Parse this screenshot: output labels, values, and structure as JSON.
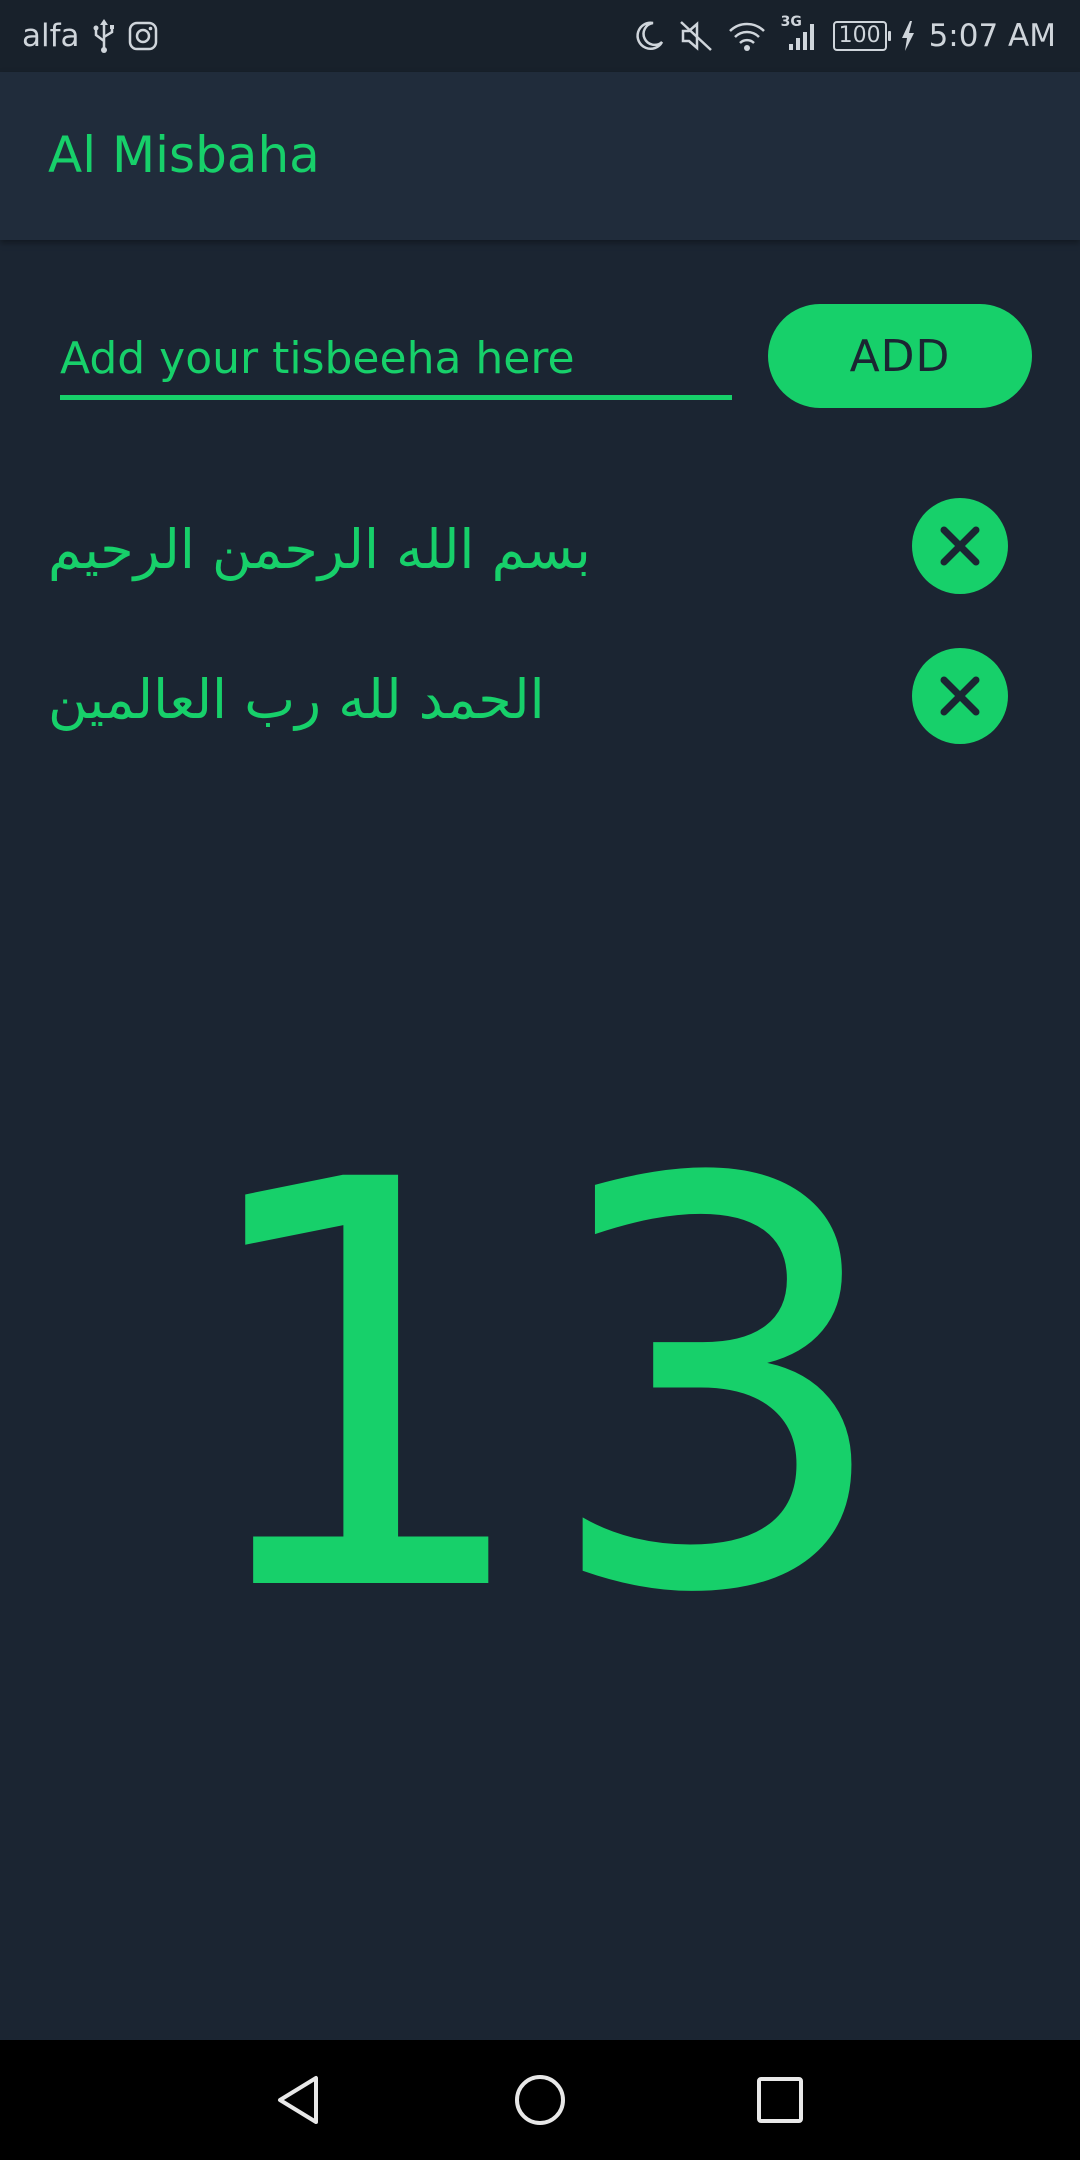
{
  "status_bar": {
    "carrier": "alfa",
    "network": "3G",
    "battery": "100",
    "time": "5:07 AM"
  },
  "app_bar": {
    "title": "Al Misbaha"
  },
  "input": {
    "placeholder": "Add your tisbeeha here",
    "value": ""
  },
  "add_button": {
    "label": "ADD"
  },
  "tisbeehas": [
    {
      "text": "بسم الله الرحمن الرحيم"
    },
    {
      "text": "الحمد لله رب العالمين"
    }
  ],
  "counter": {
    "value": "13"
  },
  "colors": {
    "accent": "#17d06a",
    "background": "#1b2532",
    "app_bar": "#202c3b",
    "status_bar": "#18212b",
    "nav_bar": "#000000"
  },
  "icons": {
    "status_left": [
      "usb-icon",
      "instagram-icon"
    ],
    "status_right": [
      "moon-icon",
      "mute-icon",
      "wifi-icon",
      "signal-icon",
      "charging-icon"
    ],
    "delete": "close-icon",
    "nav": [
      "back-icon",
      "home-icon",
      "recents-icon"
    ]
  }
}
